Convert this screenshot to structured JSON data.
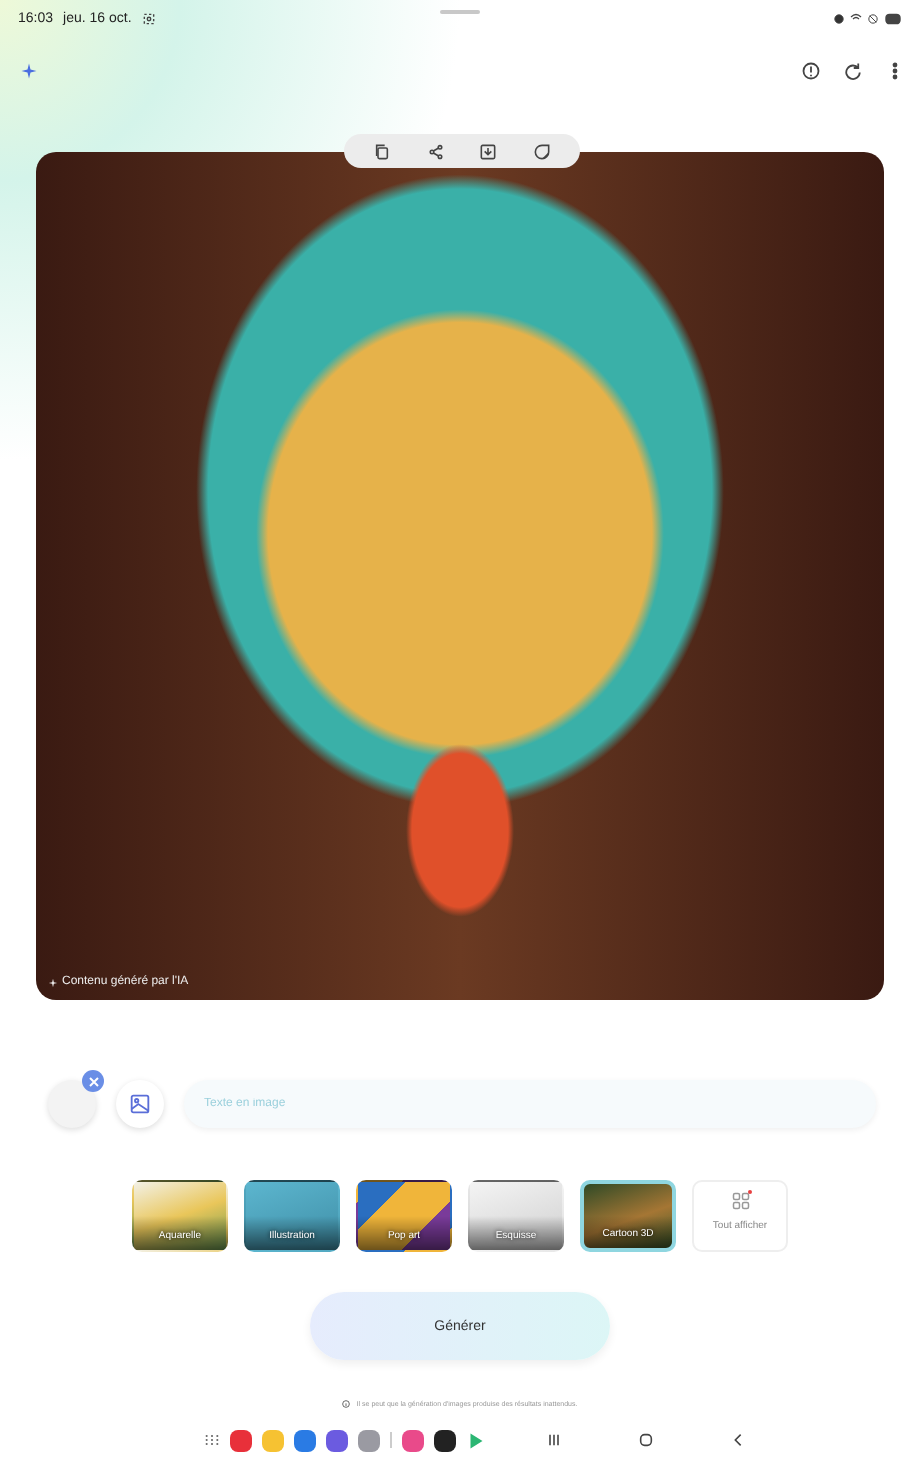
{
  "status_bar": {
    "time": "16:03",
    "date": "jeu. 16 oct."
  },
  "image": {
    "caption": "Contenu généré par l'IA"
  },
  "prompt": {
    "placeholder": "Texte en image"
  },
  "styles": [
    {
      "label": "Aquarelle",
      "selected": false,
      "kind": "style"
    },
    {
      "label": "Illustration",
      "selected": false,
      "kind": "style"
    },
    {
      "label": "Pop art",
      "selected": false,
      "kind": "style"
    },
    {
      "label": "Esquisse",
      "selected": false,
      "kind": "style"
    },
    {
      "label": "Cartoon 3D",
      "selected": true,
      "kind": "style"
    },
    {
      "label": "Tout afficher",
      "selected": false,
      "kind": "more"
    }
  ],
  "generate_button": "Générer",
  "disclaimer": "Il se peut que la génération d'images produise des résultats inattendus."
}
